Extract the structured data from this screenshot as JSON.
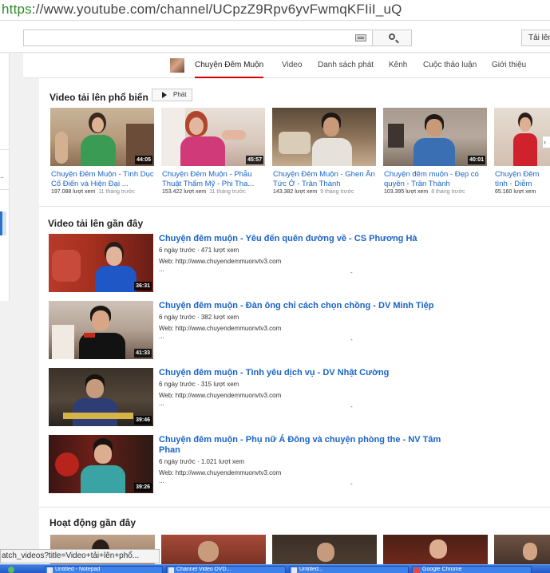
{
  "browser": {
    "url_protocol": "https",
    "url_rest": "://www.youtube.com/channel/UCpzZ9Rpv6yvFwmqKFIiI_uQ"
  },
  "masthead": {
    "upload_label": "Tải lên"
  },
  "channel": {
    "name": "Chuyện Đêm Muộn",
    "tabs": [
      "Video",
      "Danh sách phát",
      "Kênh",
      "Cuộc thảo luận",
      "Giới thiệu"
    ]
  },
  "popular": {
    "heading": "Video tải lên phổ biến",
    "play_label": "Phát",
    "items": [
      {
        "title": "Chuyện Đêm Muộn - Tình Dục Cổ Điển và Hiện Đại ...",
        "views": "197.088 lượt xem",
        "ago": "11 tháng trước",
        "duration": "44:05"
      },
      {
        "title": "Chuyện Đêm Muộn - Phẫu Thuật Thẩm Mỹ - Phi Tha...",
        "views": "153.422 lượt xem",
        "ago": "11 tháng trước",
        "duration": "45:57"
      },
      {
        "title": "Chuyện Đêm Muộn - Ghen Ăn Tức Ở - Trần Thành",
        "views": "143.382 lượt xem",
        "ago": "9 tháng trước",
        "duration": ""
      },
      {
        "title": "Chuyện đêm muộn - Đẹp có quyền - Trần Thành",
        "views": "103.395 lượt xem",
        "ago": "8 tháng trước",
        "duration": "40:01"
      },
      {
        "title": "Chuyện Đêm tình - Diễm",
        "views": "65.160 lượt xem",
        "ago": "",
        "duration": ""
      }
    ]
  },
  "recent": {
    "heading": "Video tải lên gần đây",
    "web_label": "Web:",
    "items": [
      {
        "title": "Chuyện đêm muộn - Yêu đến quên đường về - CS Phương Hà",
        "meta": "6 ngày trước · 471 lượt xem",
        "web": "http://www.chuyendemmuonvtv3.com",
        "more": "...",
        "dash": "-",
        "duration": "36:31"
      },
      {
        "title": "Chuyện đêm muộn - Đàn ông chỉ cách chọn chồng - DV Minh Tiệp",
        "meta": "6 ngày trước · 382 lượt xem",
        "web": "http://www.chuyendemmuonvtv3.com",
        "more": "...",
        "dash": "-",
        "duration": "41:33"
      },
      {
        "title": "Chuyện đêm muộn - Tình yêu dịch vụ - DV Nhật Cường",
        "meta": "6 ngày trước · 315 lượt xem",
        "web": "http://www.chuyendemmuonvtv3.com",
        "more": "...",
        "dash": "-",
        "duration": "39:46"
      },
      {
        "title": "Chuyện đêm muộn - Phụ nữ Á Đông và chuyện phòng the - NV Tâm Phan",
        "meta": "6 ngày trước · 1.021 lượt xem",
        "web": "http://www.chuyendemmuonvtv3.com",
        "more": "...",
        "dash": "-",
        "duration": "39:26"
      }
    ]
  },
  "activity": {
    "heading": "Hoạt động gần đây"
  },
  "statusbar": {
    "link": "atch_videos?title=Video+tải+lên+phổ..."
  },
  "taskbar": {
    "items": [
      "Untitled - Notepad",
      "Channel Video DVD...",
      "Untitled...",
      "Google Chrome"
    ]
  },
  "colors": {
    "link": "#1a64c7",
    "accent": "#cc0000",
    "taskbar": "#2458c8"
  }
}
